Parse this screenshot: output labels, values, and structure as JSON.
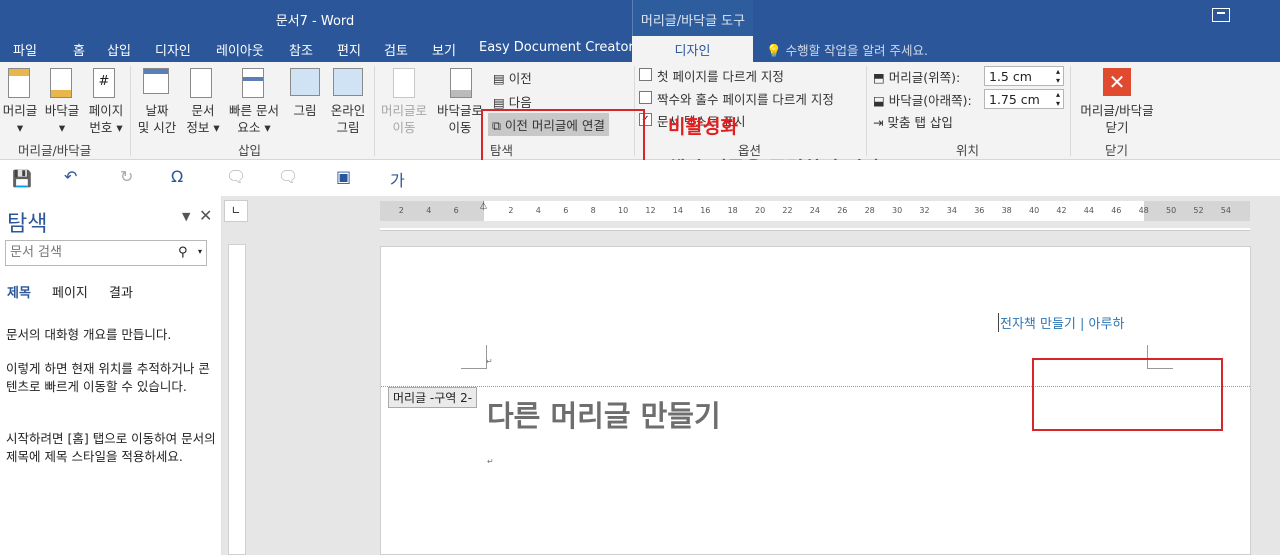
{
  "window": {
    "title": "문서7 - Word",
    "context_tab_group": "머리글/바닥글 도구"
  },
  "tabs": [
    "파일",
    "홈",
    "삽입",
    "디자인",
    "레이아웃",
    "참조",
    "편지",
    "검토",
    "보기",
    "Easy Document Creator"
  ],
  "active_tab": "디자인",
  "tell_me": "수행할 작업을 알려 주세요.",
  "ribbon": {
    "header_footer": {
      "header_label": "머리글",
      "footer_label": "바닥글",
      "page_number_label_1": "페이지",
      "page_number_label_2": "번호",
      "group_label": "머리글/바닥글"
    },
    "insert": {
      "date_1": "날짜",
      "date_2": "및 시간",
      "docinfo_1": "문서",
      "docinfo_2": "정보",
      "quickparts_1": "빠른 문서",
      "quickparts_2": "요소",
      "picture": "그림",
      "online_1": "온라인",
      "online_2": "그림",
      "group_label": "삽입"
    },
    "navigation": {
      "goto_header_1": "머리글로",
      "goto_header_2": "이동",
      "goto_footer_1": "바닥글로",
      "goto_footer_2": "이동",
      "prev": "이전",
      "next": "다음",
      "link_prev": "이전 머리글에 연결",
      "group_label": "탐색"
    },
    "options": {
      "first_page": "첫 페이지를 다르게 지정",
      "odd_even": "짝수와 홀수 페이지를 다르게 지정",
      "show_text": "문서 텍스트 표시",
      "group_label": "옵션"
    },
    "position": {
      "header_top_label": "머리글(위쪽):",
      "header_top_value": "1.5 cm",
      "footer_bottom_label": "바닥글(아래쪽):",
      "footer_bottom_value": "1.75 cm",
      "insert_align_tab": "맞춤 탭 삽입",
      "group_label": "위치"
    },
    "close": {
      "label_1": "머리글/바닥글",
      "label_2": "닫기",
      "group_label": "닫기"
    }
  },
  "annotations": {
    "line1": "비활성화",
    "line2": "해당 버튼을 클릭하면 된다."
  },
  "nav_pane": {
    "title": "탐색",
    "search_placeholder": "문서 검색",
    "tabs": [
      "제목",
      "페이지",
      "결과"
    ],
    "p1": "문서의 대화형 개요를 만듭니다.",
    "p2": "이렇게 하면 현재 위치를 추적하거나 콘텐츠로 빠르게 이동할 수 있습니다.",
    "p3": "시작하려면 [홈] 탭으로 이동하여 문서의 제목에 제목 스타일을 적용하세요."
  },
  "ruler": {
    "left_labels": [
      "6",
      "4",
      "2"
    ],
    "right_labels": [
      "2",
      "4",
      "6",
      "8",
      "10",
      "12",
      "14",
      "16",
      "18",
      "20",
      "22",
      "24",
      "26",
      "28",
      "30",
      "32",
      "34",
      "36",
      "38",
      "40",
      "42",
      "44",
      "46",
      "48",
      "50",
      "52",
      "54"
    ]
  },
  "document": {
    "header_text": "전자책 만들기 | 아루하",
    "header_tag": "머리글 -구역 2-",
    "heading": "다른 머리글 만들기"
  }
}
